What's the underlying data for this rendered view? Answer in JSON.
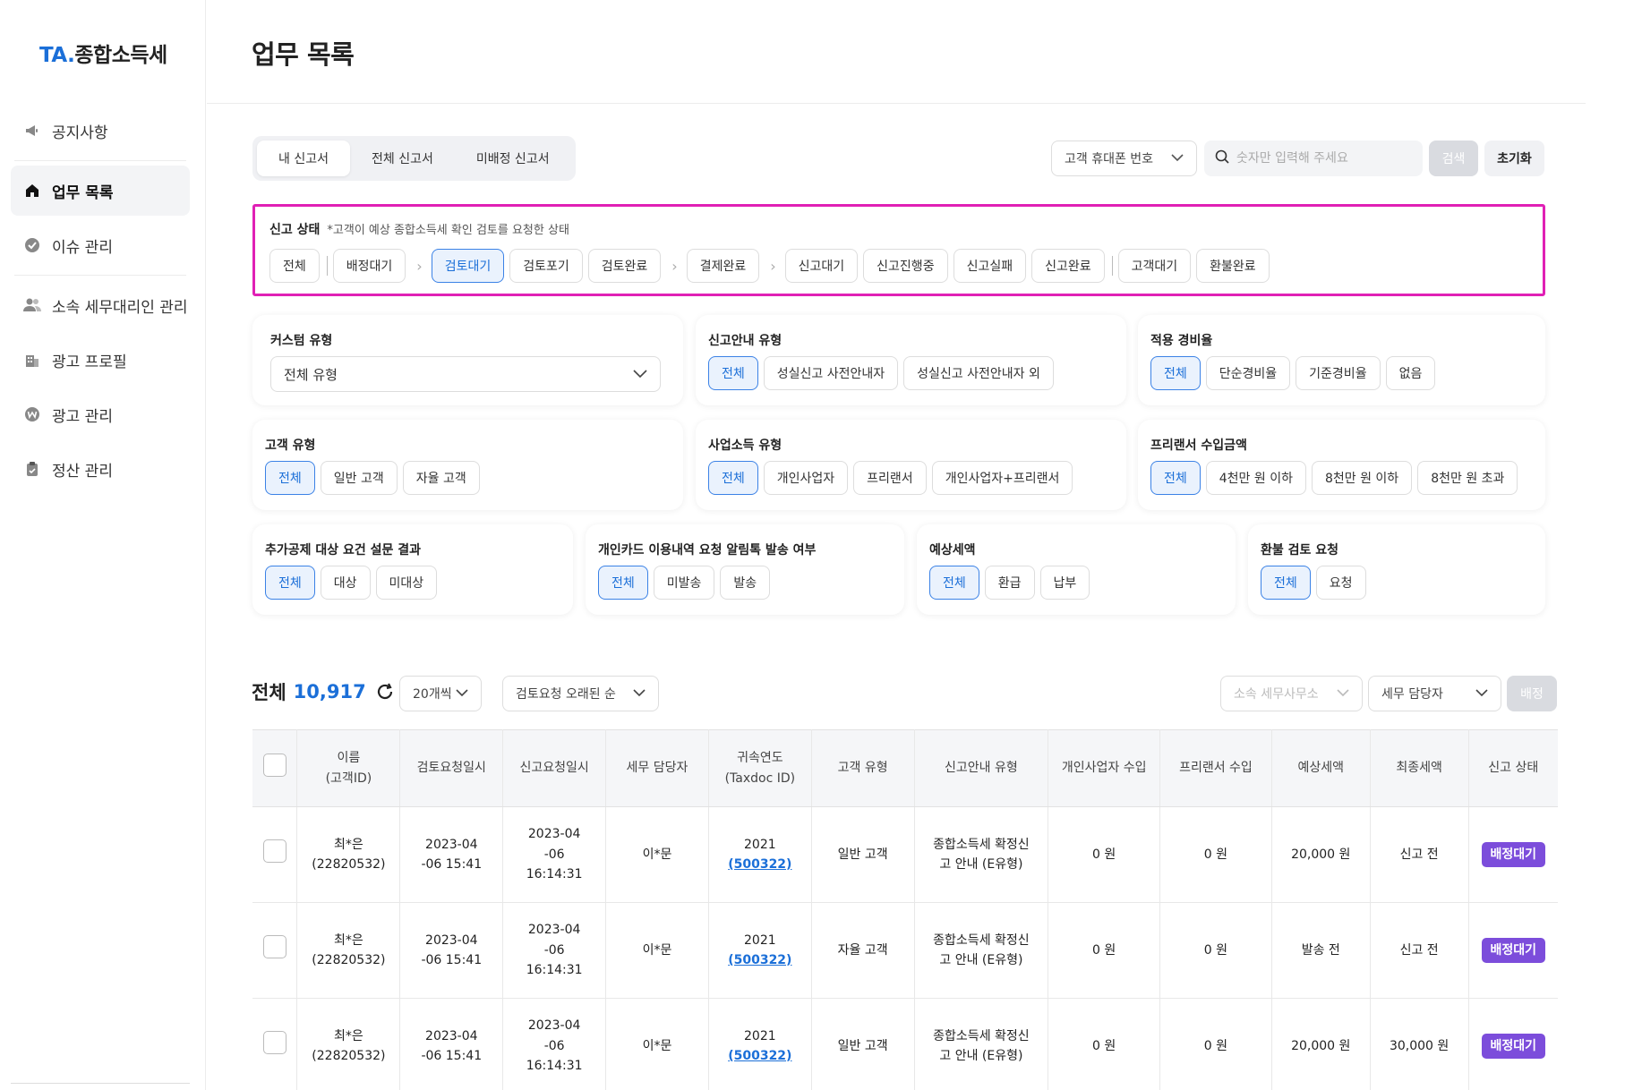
{
  "brand": {
    "prefix": "TA",
    "dot": ".",
    "name": "종합소득세"
  },
  "sidebar": {
    "items": [
      {
        "label": "공지사항",
        "icon": "megaphone-icon"
      },
      {
        "label": "업무 목록",
        "icon": "home-icon"
      },
      {
        "label": "이슈 관리",
        "icon": "check-circle-icon"
      },
      {
        "label": "소속 세무대리인 관리",
        "icon": "users-icon"
      },
      {
        "label": "광고 프로필",
        "icon": "building-icon"
      },
      {
        "label": "광고 관리",
        "icon": "won-circle-icon"
      },
      {
        "label": "정산 관리",
        "icon": "clipboard-icon"
      }
    ]
  },
  "page": {
    "title": "업무 목록"
  },
  "tabs": [
    "내 신고서",
    "전체 신고서",
    "미배정 신고서"
  ],
  "search": {
    "type": "고객 휴대폰 번호",
    "placeholder": "숫자만 입력해 주세요",
    "search_label": "검색",
    "reset_label": "초기화"
  },
  "status": {
    "title": "신고 상태",
    "note": "*고객이 예상 종합소득세 확인 검토를 요청한 상태",
    "chips": [
      "전체",
      "배정대기",
      "검토대기",
      "검토포기",
      "검토완료",
      "결제완료",
      "신고대기",
      "신고진행중",
      "신고실패",
      "신고완료",
      "고객대기",
      "환불완료"
    ],
    "selected": "검토대기"
  },
  "filters": {
    "custom_type": {
      "title": "커스텀 유형",
      "value": "전체 유형"
    },
    "report_guide": {
      "title": "신고안내 유형",
      "options": [
        "전체",
        "성실신고 사전안내자",
        "성실신고 사전안내자 외"
      ]
    },
    "expense_rate": {
      "title": "적용 경비율",
      "options": [
        "전체",
        "단순경비율",
        "기준경비율",
        "없음"
      ]
    },
    "customer_type": {
      "title": "고객 유형",
      "options": [
        "전체",
        "일반 고객",
        "자율 고객"
      ]
    },
    "business_income": {
      "title": "사업소득 유형",
      "options": [
        "전체",
        "개인사업자",
        "프리랜서",
        "개인사업자+프리랜서"
      ]
    },
    "freelancer_income": {
      "title": "프리랜서 수입금액",
      "options": [
        "전체",
        "4천만 원 이하",
        "8천만 원 이하",
        "8천만 원 초과"
      ]
    },
    "survey": {
      "title": "추가공제 대상 요건 설문 결과",
      "options": [
        "전체",
        "대상",
        "미대상"
      ]
    },
    "card_notice": {
      "title": "개인카드 이용내역 요청 알림톡 발송 여부",
      "options": [
        "전체",
        "미발송",
        "발송"
      ]
    },
    "expected_tax": {
      "title": "예상세액",
      "options": [
        "전체",
        "환급",
        "납부"
      ]
    },
    "refund_review": {
      "title": "환불 검토 요청",
      "options": [
        "전체",
        "요청"
      ]
    }
  },
  "list": {
    "total_label": "전체",
    "total_count": "10,917",
    "page_size": "20개씩",
    "sort": "검토요청 오래된 순",
    "office": "소속 세무사무소",
    "manager": "세무 담당자",
    "assign_label": "배정"
  },
  "table": {
    "headers": [
      [
        "이름",
        "(고객ID)"
      ],
      [
        "검토요청일시"
      ],
      [
        "신고요청일시"
      ],
      [
        "세무 담당자"
      ],
      [
        "귀속연도",
        "(Taxdoc ID)"
      ],
      [
        "고객 유형"
      ],
      [
        "신고안내 유형"
      ],
      [
        "개인사업자 수입"
      ],
      [
        "프리랜서 수입"
      ],
      [
        "예상세액"
      ],
      [
        "최종세액"
      ],
      [
        "신고 상태"
      ]
    ],
    "rows": [
      {
        "name": "최*은",
        "id": "(22820532)",
        "review_date": "2023-04",
        "review_time": "-06 15:41",
        "req_1": "2023-04",
        "req_2": "-06",
        "req_3": "16:14:31",
        "manager": "이*문",
        "year": "2021",
        "taxdoc": "(500322)",
        "ctype": "일반 고객",
        "guide_1": "종합소득세 확정신",
        "guide_2": "고 안내 (E유형)",
        "biz": "0 원",
        "free": "0 원",
        "expected": "20,000 원",
        "final": "신고 전",
        "status": "배정대기"
      },
      {
        "name": "최*은",
        "id": "(22820532)",
        "review_date": "2023-04",
        "review_time": "-06 15:41",
        "req_1": "2023-04",
        "req_2": "-06",
        "req_3": "16:14:31",
        "manager": "이*문",
        "year": "2021",
        "taxdoc": "(500322)",
        "ctype": "자율 고객",
        "guide_1": "종합소득세 확정신",
        "guide_2": "고 안내 (E유형)",
        "biz": "0 원",
        "free": "0 원",
        "expected": "발송 전",
        "final": "신고 전",
        "status": "배정대기"
      },
      {
        "name": "최*은",
        "id": "(22820532)",
        "review_date": "2023-04",
        "review_time": "-06 15:41",
        "req_1": "2023-04",
        "req_2": "-06",
        "req_3": "16:14:31",
        "manager": "이*문",
        "year": "2021",
        "taxdoc": "(500322)",
        "ctype": "일반 고객",
        "guide_1": "종합소득세 확정신",
        "guide_2": "고 안내 (E유형)",
        "biz": "0 원",
        "free": "0 원",
        "expected": "20,000 원",
        "final": "30,000 원",
        "status": "배정대기"
      }
    ]
  },
  "colors": {
    "accent": "#1b6fd8",
    "highlight_border": "#e020b5",
    "badge": "#7c4ddb"
  }
}
